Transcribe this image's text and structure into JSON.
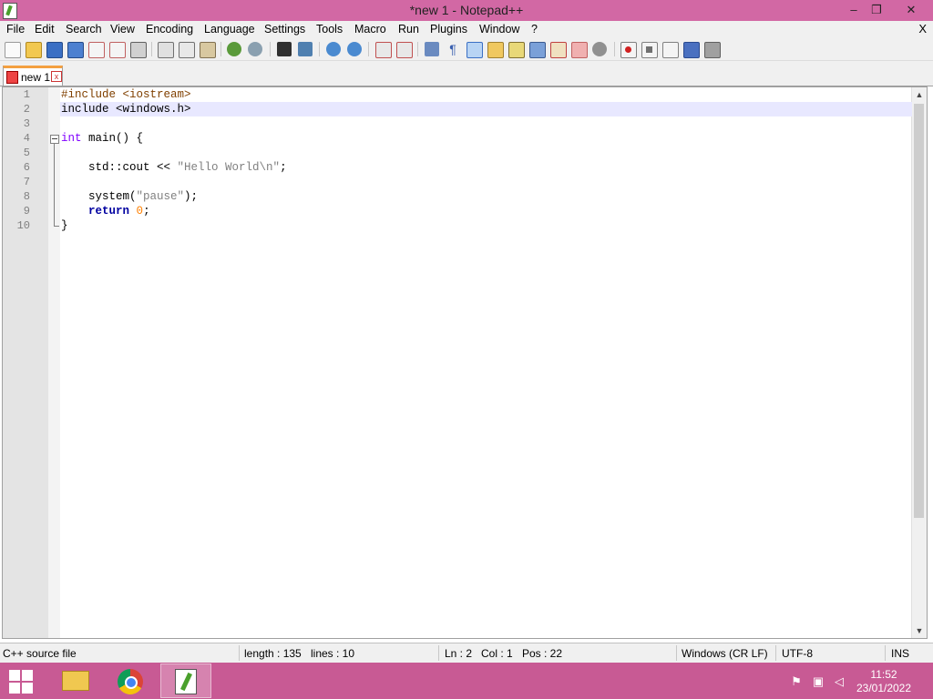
{
  "window": {
    "title": "*new 1 - Notepad++",
    "controls": {
      "minimize": "–",
      "restore": "❐",
      "close": "✕"
    }
  },
  "menu": {
    "items": [
      "File",
      "Edit",
      "Search",
      "View",
      "Encoding",
      "Language",
      "Settings",
      "Tools",
      "Macro",
      "Run",
      "Plugins",
      "Window",
      "?"
    ],
    "close_doc": "X"
  },
  "toolbar": {
    "icons": [
      "new-file-icon",
      "open-file-icon",
      "save-icon",
      "save-all-icon",
      "close-icon",
      "close-all-icon",
      "print-icon",
      "cut-icon",
      "copy-icon",
      "paste-icon",
      "undo-icon",
      "redo-icon",
      "find-icon",
      "replace-icon",
      "zoom-in-icon",
      "zoom-out-icon",
      "sync-vertical-icon",
      "sync-horizontal-icon",
      "word-wrap-icon",
      "show-all-chars-icon",
      "indent-guide-icon",
      "udl-icon",
      "doc-map-icon",
      "function-list-icon",
      "folder-workspace-icon",
      "monitoring-icon",
      "record-macro-icon",
      "stop-macro-icon",
      "play-macro-icon",
      "run-macro-multiple-icon",
      "save-macro-icon"
    ]
  },
  "tabs": [
    {
      "label": "new 1",
      "close": "x"
    }
  ],
  "editor": {
    "current_line": 2,
    "lines": [
      {
        "n": "1",
        "tokens": [
          {
            "t": "#include <iostream>",
            "c": "pre"
          }
        ]
      },
      {
        "n": "2",
        "tokens": [
          {
            "t": "include <windows.h>",
            "c": ""
          }
        ]
      },
      {
        "n": "3",
        "tokens": []
      },
      {
        "n": "4",
        "tokens": [
          {
            "t": "int",
            "c": "kw"
          },
          {
            "t": " main() {",
            "c": ""
          }
        ]
      },
      {
        "n": "5",
        "tokens": []
      },
      {
        "n": "6",
        "tokens": [
          {
            "t": "    std::cout << ",
            "c": ""
          },
          {
            "t": "\"Hello World\\n\"",
            "c": "str"
          },
          {
            "t": ";",
            "c": ""
          }
        ]
      },
      {
        "n": "7",
        "tokens": []
      },
      {
        "n": "8",
        "tokens": [
          {
            "t": "    system(",
            "c": ""
          },
          {
            "t": "\"pause\"",
            "c": "str"
          },
          {
            "t": ");",
            "c": ""
          }
        ]
      },
      {
        "n": "9",
        "tokens": [
          {
            "t": "    ",
            "c": ""
          },
          {
            "t": "return",
            "c": "kw2"
          },
          {
            "t": " ",
            "c": ""
          },
          {
            "t": "0",
            "c": "num"
          },
          {
            "t": ";",
            "c": ""
          }
        ]
      },
      {
        "n": "10",
        "tokens": [
          {
            "t": "}",
            "c": ""
          }
        ]
      }
    ]
  },
  "status": {
    "language": "C++ source file",
    "length": "length : 135",
    "lines": "lines : 10",
    "ln": "Ln : 2",
    "col": "Col : 1",
    "pos": "Pos : 22",
    "eol": "Windows (CR LF)",
    "encoding": "UTF-8",
    "mode": "INS"
  },
  "taskbar": {
    "apps": [
      "file-explorer-icon",
      "chrome-icon",
      "notepadpp-icon"
    ],
    "clock_time": "11:52",
    "clock_date": "23/01/2022"
  },
  "colors": {
    "titlebar": "#d268a4",
    "taskbar": "#c85a94",
    "current_line": "#e8e8ff"
  }
}
